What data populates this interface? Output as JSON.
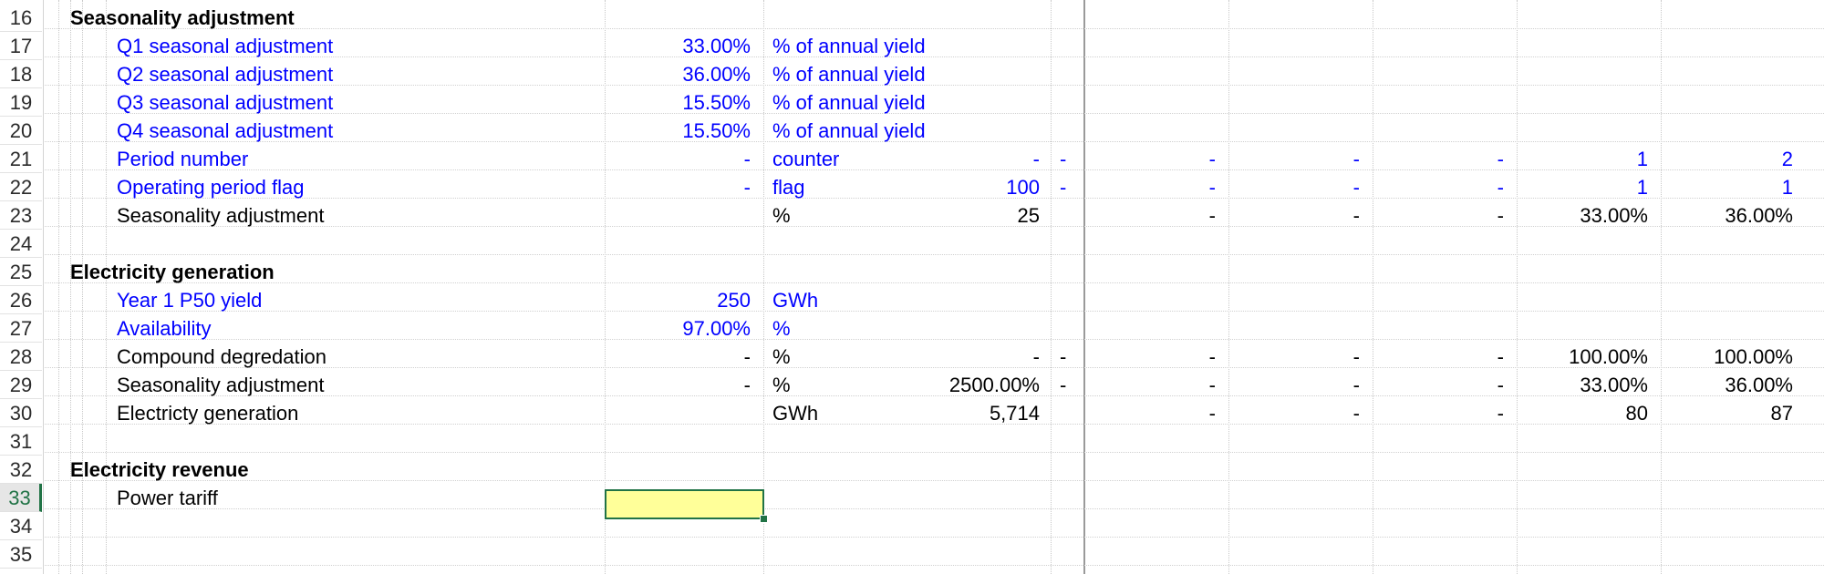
{
  "sheet": {
    "row_numbers": [
      "16",
      "17",
      "18",
      "19",
      "20",
      "21",
      "22",
      "23",
      "24",
      "25",
      "26",
      "27",
      "28",
      "29",
      "30",
      "31",
      "32",
      "33",
      "34",
      "35"
    ],
    "active_row": "33",
    "sections": {
      "seasonality": "Seasonality adjustment",
      "generation": "Electricity generation",
      "revenue": "Electricity revenue"
    },
    "rows": {
      "r17": {
        "label": "Q1 seasonal adjustment",
        "value": "33.00%",
        "unit": "% of annual yield"
      },
      "r18": {
        "label": "Q2 seasonal adjustment",
        "value": "36.00%",
        "unit": "% of annual yield"
      },
      "r19": {
        "label": "Q3 seasonal adjustment",
        "value": "15.50%",
        "unit": "% of annual yield"
      },
      "r20": {
        "label": "Q4 seasonal adjustment",
        "value": "15.50%",
        "unit": "% of annual yield"
      },
      "r21": {
        "label": "Period number",
        "value": "-",
        "unit": "counter",
        "total": "-",
        "c1": "-",
        "c2": "-",
        "c3": "-",
        "c4": "-",
        "c5": "1",
        "c6": "2"
      },
      "r22": {
        "label": "Operating period flag",
        "value": "-",
        "unit": "flag",
        "total": "100",
        "c1": "-",
        "c2": "-",
        "c3": "-",
        "c4": "-",
        "c5": "1",
        "c6": "1"
      },
      "r23": {
        "label": "Seasonality adjustment",
        "unit": "%",
        "total": "25",
        "c2": "-",
        "c3": "-",
        "c4": "-",
        "c5": "33.00%",
        "c6": "36.00%"
      },
      "r26": {
        "label": "Year 1 P50 yield",
        "value": "250",
        "unit": "GWh"
      },
      "r27": {
        "label": "Availability",
        "value": "97.00%",
        "unit": "%"
      },
      "r28": {
        "label": "Compound degredation",
        "value": "-",
        "unit": "%",
        "total": "-",
        "c1": "-",
        "c2": "-",
        "c3": "-",
        "c4": "-",
        "c5": "100.00%",
        "c6": "100.00%"
      },
      "r29": {
        "label": "Seasonality adjustment",
        "value": "-",
        "unit": "%",
        "total": "2500.00%",
        "c1": "-",
        "c2": "-",
        "c3": "-",
        "c4": "-",
        "c5": "33.00%",
        "c6": "36.00%"
      },
      "r30": {
        "label": "Electricty generation",
        "unit": "GWh",
        "total": "5,714",
        "c2": "-",
        "c3": "-",
        "c4": "-",
        "c5": "80",
        "c6": "87"
      },
      "r33": {
        "label": "Power tariff"
      }
    }
  }
}
